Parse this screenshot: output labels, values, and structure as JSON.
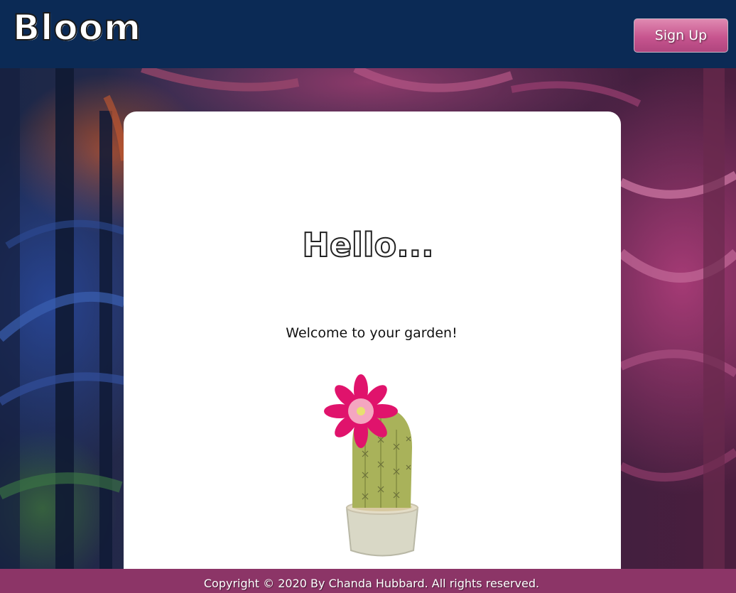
{
  "header": {
    "logo": "Bloom",
    "signup_label": "Sign Up"
  },
  "main": {
    "heading": "Hello...",
    "welcome": "Welcome to your garden!",
    "illustration": "cactus-icon"
  },
  "footer": {
    "copyright": "Copyright © 2020 By Chanda Hubbard. All rights reserved."
  },
  "colors": {
    "header_bg": "#0b2a55",
    "footer_bg": "#8c3567",
    "button": "#c7558f",
    "card": "#ffffff"
  }
}
